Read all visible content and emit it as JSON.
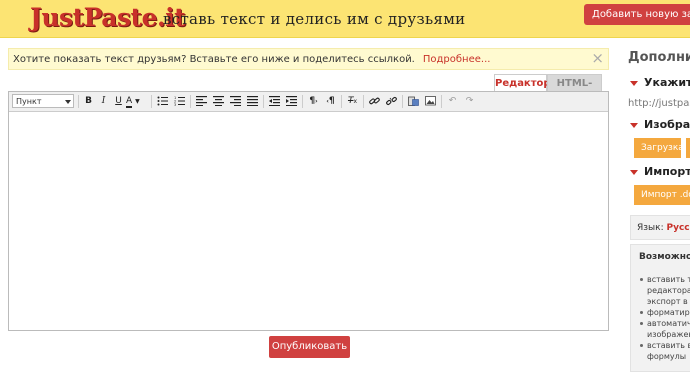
{
  "header": {
    "logo": "JustPaste.it",
    "slogan": "вставь текст и делись им с друзьями",
    "add_note_button": "Добавить новую заметку"
  },
  "notice": {
    "text": "Хотите показать текст друзьям? Вставьте его ниже и поделитесь ссылкой.",
    "link": "Подробнее...",
    "close": "×"
  },
  "tabs": {
    "editor": "Редактор",
    "html": "HTML-код"
  },
  "toolbar": {
    "format_select": "Пункт"
  },
  "publish_button": "Опубликовать",
  "sidebar": {
    "title": "Дополнит",
    "section_url": "Укажите а",
    "url_placeholder": "http://justpaste",
    "section_images": "Изображ",
    "upload_button": "Загрузка",
    "section_import": "Импорт и",
    "import_button": "Импорт .doc",
    "language_label": "Язык:",
    "language_value": "Русск",
    "features_title": "Возможнос",
    "features": [
      "вставить те",
      "редактора",
      "экспорт в P",
      "форматиро",
      "автоматич",
      "изображен",
      "вставить в",
      "формулы"
    ]
  }
}
